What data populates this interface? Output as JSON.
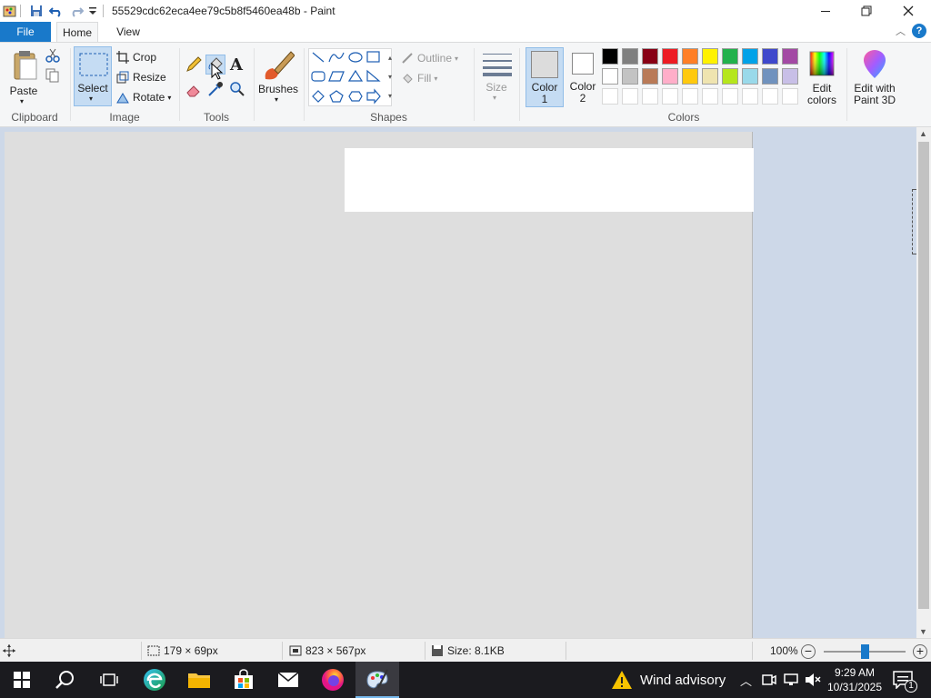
{
  "window": {
    "title": "55529cdc62eca4ee79c5b8f5460ea48b - Paint",
    "quick_access": [
      "paint-app-icon",
      "save-icon",
      "undo-icon",
      "redo-icon",
      "customize-quick-access-icon"
    ],
    "controls": {
      "minimize": "minimize-icon",
      "maximize": "maximize-icon",
      "close": "close-icon"
    }
  },
  "tabs": {
    "file": "File",
    "home": "Home",
    "view": "View"
  },
  "ribbon": {
    "clipboard": {
      "label": "Clipboard",
      "paste": "Paste"
    },
    "image": {
      "label": "Image",
      "select": "Select",
      "crop": "Crop",
      "resize": "Resize",
      "rotate": "Rotate"
    },
    "tools": {
      "label": "Tools"
    },
    "brushes": {
      "label": "Brushes"
    },
    "shapes": {
      "label": "Shapes",
      "outline": "Outline",
      "fill": "Fill"
    },
    "size": {
      "label": "Size"
    },
    "colors": {
      "label": "Colors",
      "color1_l1": "Color",
      "color1_l2": "1",
      "color2_l1": "Color",
      "color2_l2": "2",
      "row1": [
        "#000000",
        "#7f7f7f",
        "#880015",
        "#ed1c24",
        "#ff7f27",
        "#fff200",
        "#22b14c",
        "#00a2e8",
        "#3f48cc",
        "#a349a4"
      ],
      "row2": [
        "#ffffff",
        "#c3c3c3",
        "#b97a57",
        "#ffaec9",
        "#ffc90e",
        "#efe4b0",
        "#b5e61d",
        "#99d9ea",
        "#7092be",
        "#c8bfe7"
      ],
      "edit_colors_l1": "Edit",
      "edit_colors_l2": "colors"
    },
    "paint3d": {
      "l1": "Edit with",
      "l2": "Paint 3D"
    }
  },
  "status": {
    "selection_size": "179 × 69px",
    "canvas_size": "823 × 567px",
    "file_size": "Size: 8.1KB",
    "zoom": "100%",
    "zoom_slider_level": 0.5
  },
  "taskbar": {
    "weather": "Wind advisory",
    "time": "9:29 AM",
    "date": "10/31/2025",
    "notification_count": "1"
  }
}
